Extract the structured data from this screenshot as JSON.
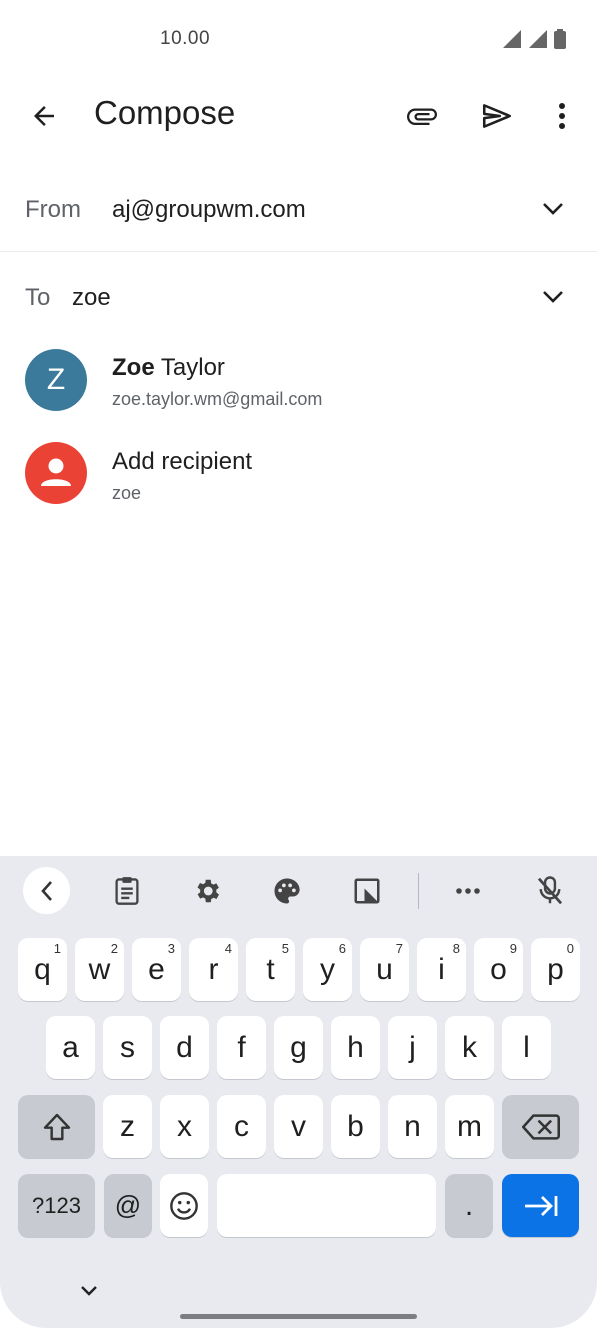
{
  "status": {
    "time": "10.00"
  },
  "appbar": {
    "title": "Compose"
  },
  "from": {
    "label": "From",
    "value": "aj@groupwm.com"
  },
  "to": {
    "label": "To",
    "value": "zoe"
  },
  "suggestions": [
    {
      "initial": "Z",
      "name_bold": "Zoe",
      "name_rest": " Taylor",
      "subtitle": "zoe.taylor.wm@gmail.com"
    },
    {
      "name": "Add recipient",
      "subtitle": "zoe"
    }
  ],
  "keyboard": {
    "row1": [
      {
        "l": "q",
        "h": "1"
      },
      {
        "l": "w",
        "h": "2"
      },
      {
        "l": "e",
        "h": "3"
      },
      {
        "l": "r",
        "h": "4"
      },
      {
        "l": "t",
        "h": "5"
      },
      {
        "l": "y",
        "h": "6"
      },
      {
        "l": "u",
        "h": "7"
      },
      {
        "l": "i",
        "h": "8"
      },
      {
        "l": "o",
        "h": "9"
      },
      {
        "l": "p",
        "h": "0"
      }
    ],
    "row2": [
      "a",
      "s",
      "d",
      "f",
      "g",
      "h",
      "j",
      "k",
      "l"
    ],
    "row3": [
      "z",
      "x",
      "c",
      "v",
      "b",
      "n",
      "m"
    ],
    "symbols_label": "?123",
    "at_label": "@",
    "period_label": "."
  },
  "colors": {
    "accent_blue": "#0b73e6",
    "avatar_teal": "#3b7a9a",
    "avatar_red": "#ea4335",
    "keyboard_bg": "#e8eaef"
  }
}
